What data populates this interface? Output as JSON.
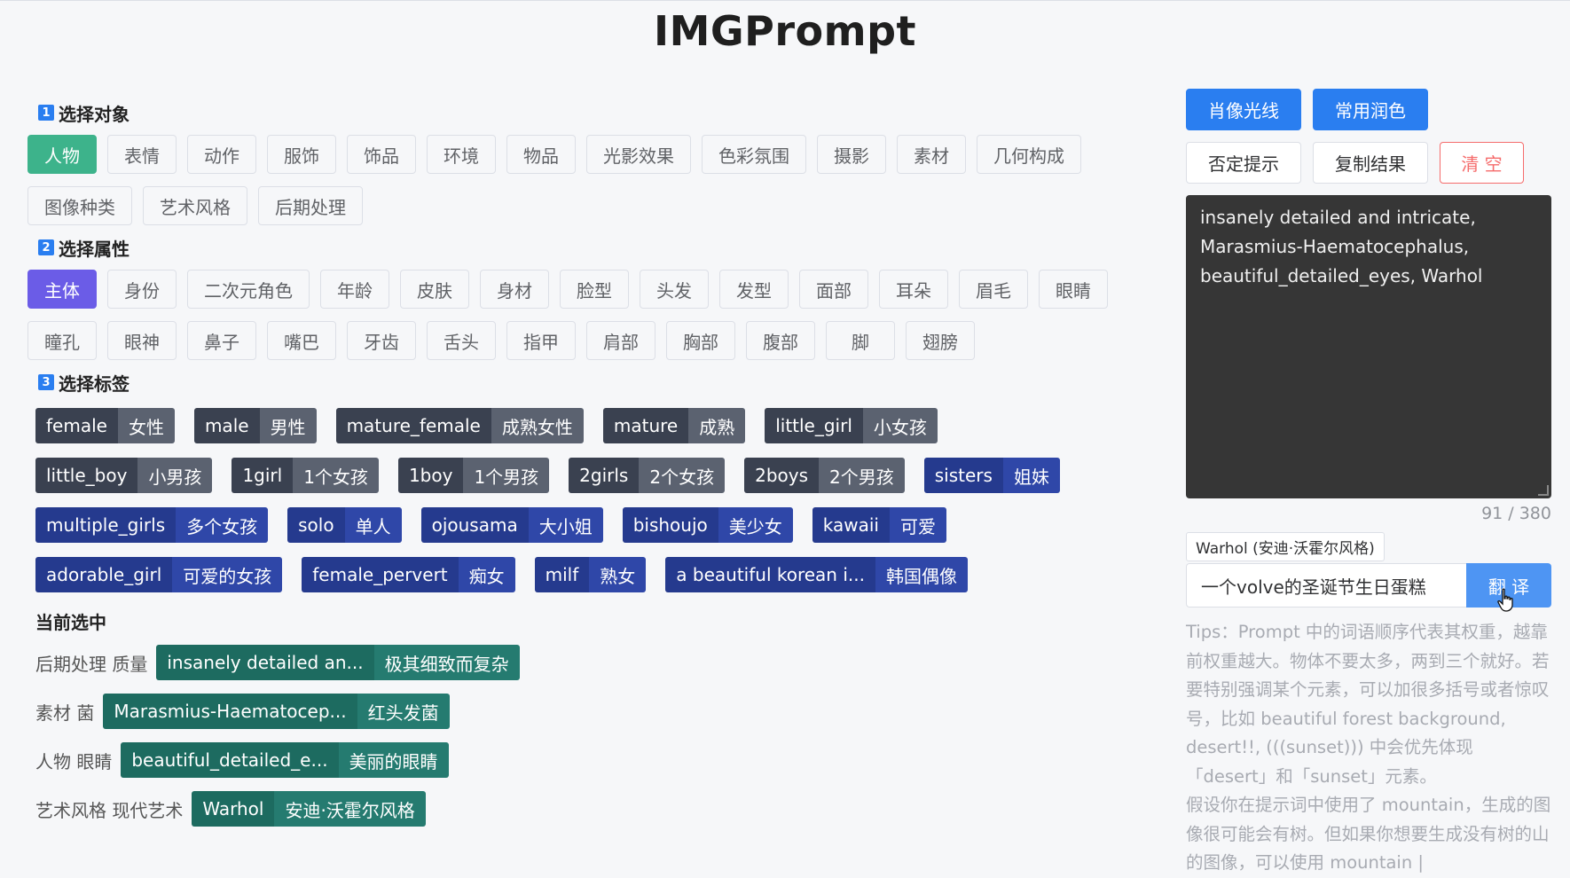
{
  "app": {
    "title": "IMGPrompt"
  },
  "sections": {
    "step1": {
      "num": "1",
      "label": "选择对象"
    },
    "step2": {
      "num": "2",
      "label": "选择属性"
    },
    "step3": {
      "num": "3",
      "label": "选择标签"
    }
  },
  "objects": [
    "人物",
    "表情",
    "动作",
    "服饰",
    "饰品",
    "环境",
    "物品",
    "光影效果",
    "色彩氛围",
    "摄影",
    "素材",
    "几何构成",
    "图像种类",
    "艺术风格",
    "后期处理"
  ],
  "attributes": [
    "主体",
    "身份",
    "二次元角色",
    "年龄",
    "皮肤",
    "身材",
    "脸型",
    "头发",
    "发型",
    "面部",
    "耳朵",
    "眉毛",
    "眼睛",
    "瞳孔",
    "眼神",
    "鼻子",
    "嘴巴",
    "牙齿",
    "舌头",
    "指甲",
    "肩部",
    "胸部",
    "腹部",
    "脚",
    "翅膀"
  ],
  "tags_gray": [
    {
      "en": "female",
      "zh": "女性"
    },
    {
      "en": "male",
      "zh": "男性"
    },
    {
      "en": "mature_female",
      "zh": "成熟女性"
    },
    {
      "en": "mature",
      "zh": "成熟"
    },
    {
      "en": "little_girl",
      "zh": "小女孩"
    },
    {
      "en": "little_boy",
      "zh": "小男孩"
    },
    {
      "en": "1girl",
      "zh": "1个女孩"
    },
    {
      "en": "1boy",
      "zh": "1个男孩"
    },
    {
      "en": "2girls",
      "zh": "2个女孩"
    },
    {
      "en": "2boys",
      "zh": "2个男孩"
    }
  ],
  "tags_navy": [
    {
      "en": "sisters",
      "zh": "姐妹"
    },
    {
      "en": "multiple_girls",
      "zh": "多个女孩"
    },
    {
      "en": "solo",
      "zh": "单人"
    },
    {
      "en": "ojousama",
      "zh": "大小姐"
    },
    {
      "en": "bishoujo",
      "zh": "美少女"
    },
    {
      "en": "kawaii",
      "zh": "可爱"
    },
    {
      "en": "adorable_girl",
      "zh": "可爱的女孩"
    },
    {
      "en": "female_pervert",
      "zh": "痴女"
    },
    {
      "en": "milf",
      "zh": "熟女"
    },
    {
      "en": "a beautiful korean i...",
      "zh": "韩国偶像"
    }
  ],
  "current": {
    "title": "当前选中",
    "items": [
      {
        "label": "后期处理 质量",
        "en": "insanely detailed an...",
        "zh": "极其细致而复杂"
      },
      {
        "label": "素材 菌",
        "en": "Marasmius-Haematocep...",
        "zh": "红头发菌"
      },
      {
        "label": "人物 眼睛",
        "en": "beautiful_detailed_e...",
        "zh": "美丽的眼睛"
      },
      {
        "label": "艺术风格 现代艺术",
        "en": "Warhol",
        "zh": "安迪·沃霍尔风格"
      }
    ]
  },
  "right": {
    "buttons_row1": [
      "肖像光线",
      "常用润色"
    ],
    "buttons_row2": [
      "否定提示",
      "复制结果",
      "清 空"
    ],
    "result_text": "insanely detailed and intricate, Marasmius-Haematocephalus, beautiful_detailed_eyes, Warhol",
    "counter": "91 / 380",
    "hint_chip": "Warhol (安迪·沃霍尔风格)",
    "translate_input": "一个volve的圣诞节生日蛋糕",
    "translate_button": "翻 译",
    "tips_p1": "Tips：Prompt 中的词语顺序代表其权重，越靠前权重越大。物体不要太多，两到三个就好。若要特别强调某个元素，可以加很多括号或者惊叹号，比如 beautiful forest background, desert!!, (((sunset))) 中会优先体现「desert」和「sunset」元素。",
    "tips_p2": "假设你在提示词中使用了 mountain，生成的图像很可能会有树。但如果你想要生成没有树的山的图像，可以使用 mountain |"
  },
  "colors": {
    "primary": "#2a7ef0",
    "active_green": "#3db38b",
    "active_purple": "#6b5ce7",
    "danger": "#f56c6c"
  }
}
